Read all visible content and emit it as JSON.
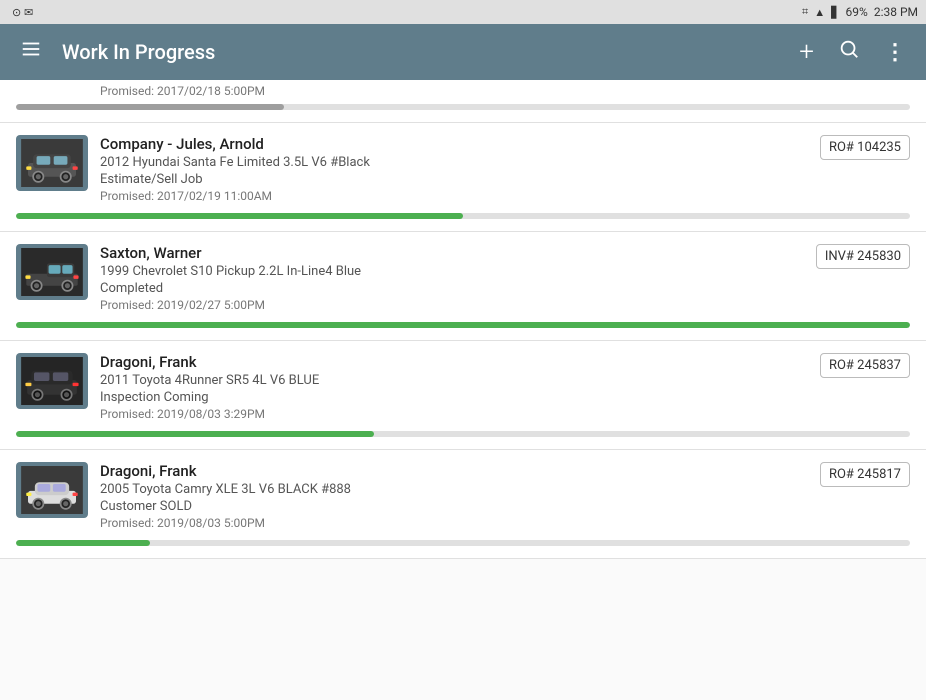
{
  "statusBar": {
    "time": "2:38 PM",
    "battery": "69%",
    "bluetooth": "⌘",
    "wifi": "wifi",
    "signal": "signal"
  },
  "appBar": {
    "title": "Work In Progress",
    "menuIcon": "menu",
    "addIcon": "+",
    "searchIcon": "search",
    "moreIcon": "⋮"
  },
  "partialItem": {
    "promised": "Promised: 2017/02/18 5:00PM",
    "progressPct": 30
  },
  "items": [
    {
      "id": "item-1",
      "name": "Company - Jules, Arnold",
      "vehicle": "2012 Hyundai Santa Fe Limited 3.5L V6  #Black",
      "status": "Estimate/Sell Job",
      "promised": "Promised: 2017/02/19 11:00AM",
      "badge": "RO# 104235",
      "progressPct": 50,
      "carColor": "#444",
      "carType": "suv"
    },
    {
      "id": "item-2",
      "name": "Saxton, Warner",
      "vehicle": "1999 Chevrolet S10 Pickup  2.2L In-Line4 Blue",
      "status": "Completed",
      "promised": "Promised: 2019/02/27 5:00PM",
      "badge": "INV# 245830",
      "progressPct": 100,
      "carColor": "#555",
      "carType": "truck"
    },
    {
      "id": "item-3",
      "name": "Dragoni, Frank",
      "vehicle": "2011 Toyota 4Runner SR5 4L V6 BLUE",
      "status": "Inspection Coming",
      "promised": "Promised: 2019/08/03 3:29PM",
      "badge": "RO# 245837",
      "progressPct": 40,
      "carColor": "#333",
      "carType": "suv"
    },
    {
      "id": "item-4",
      "name": "Dragoni, Frank",
      "vehicle": "2005 Toyota Camry XLE 3L V6 BLACK #888",
      "status": "Customer SOLD",
      "promised": "Promised: 2019/08/03 5:00PM",
      "badge": "RO# 245817",
      "progressPct": 15,
      "carColor": "#222",
      "carType": "sedan"
    }
  ]
}
